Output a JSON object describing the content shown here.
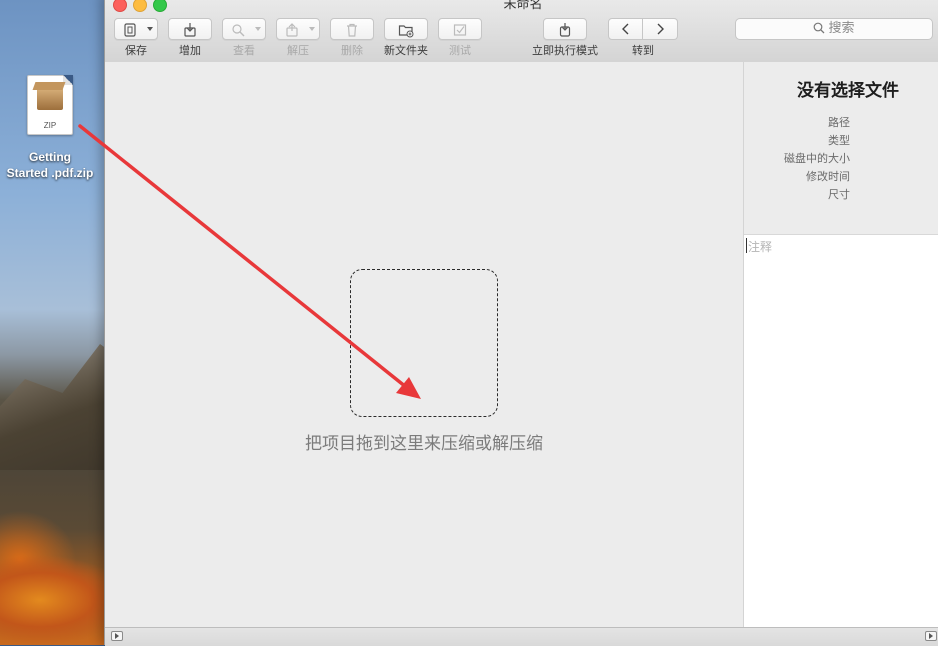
{
  "desktop": {
    "file_icon_label": "ZIP",
    "file_name_line1": "Getting",
    "file_name_line2": "Started .pdf.zip"
  },
  "window": {
    "title": "未命名"
  },
  "toolbar": {
    "save_label": "保存",
    "add_label": "增加",
    "view_label": "查看",
    "extract_label": "解压",
    "delete_label": "删除",
    "new_folder_label": "新文件夹",
    "test_label": "测试",
    "run_mode_label": "立即执行模式",
    "goto_label": "转到"
  },
  "search": {
    "placeholder": "搜索"
  },
  "main": {
    "drop_hint": "把项目拖到这里来压缩或解压缩"
  },
  "info": {
    "title": "没有选择文件",
    "path_label": "路径",
    "type_label": "类型",
    "disk_size_label": "磁盘中的大小",
    "modified_label": "修改时间",
    "size_label": "尺寸",
    "comment_placeholder": "注释"
  },
  "colors": {
    "annotation_arrow": "#e8383a"
  }
}
